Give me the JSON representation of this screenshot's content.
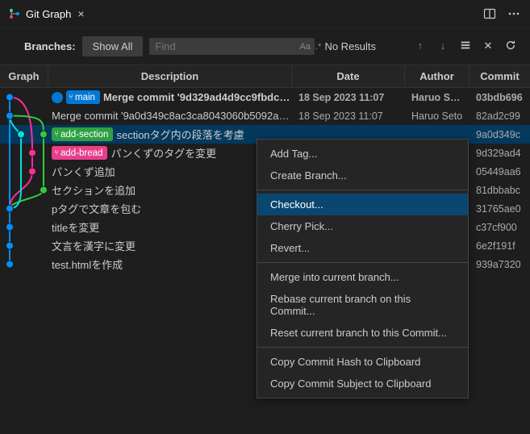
{
  "tab": {
    "title": "Git Graph"
  },
  "toolbar": {
    "branches_label": "Branches:",
    "branches_value": "Show All",
    "search_placeholder": "Find",
    "no_results": "No Results"
  },
  "headers": {
    "graph": "Graph",
    "description": "Description",
    "date": "Date",
    "author": "Author",
    "commit": "Commit"
  },
  "colors": {
    "blue": "#0090ff",
    "green": "#2ecc40",
    "pink": "#ff2e9a",
    "cyan": "#00e0e0"
  },
  "rows": [
    {
      "bold": true,
      "selected": false,
      "head": true,
      "branches": [
        {
          "style": "bt-blue",
          "label": "main"
        }
      ],
      "desc": "Merge commit '9d329ad4d9cc9fbdc…",
      "date": "18 Sep 2023 11:07",
      "author": "Haruo Seto",
      "hash": "03bdb696"
    },
    {
      "bold": false,
      "selected": false,
      "head": false,
      "branches": [],
      "desc": "Merge commit '9a0d349c8ac3ca8043060b5092a35c…",
      "date": "18 Sep 2023 11:07",
      "author": "Haruo Seto",
      "hash": "82ad2c99"
    },
    {
      "bold": false,
      "selected": true,
      "head": false,
      "branches": [
        {
          "style": "bt-green",
          "label": "add-section"
        }
      ],
      "desc": "sectionタグ内の段落を考慮",
      "date": "",
      "author": "",
      "hash": "9a0d349c"
    },
    {
      "bold": false,
      "selected": false,
      "head": false,
      "branches": [
        {
          "style": "bt-pink",
          "label": "add-bread"
        }
      ],
      "desc": "パンくずのタグを変更",
      "date": "",
      "author": "",
      "hash": "9d329ad4"
    },
    {
      "bold": false,
      "selected": false,
      "head": false,
      "branches": [],
      "desc": "パンくず追加",
      "date": "",
      "author": "",
      "hash": "05449aa6"
    },
    {
      "bold": false,
      "selected": false,
      "head": false,
      "branches": [],
      "desc": "セクションを追加",
      "date": "",
      "author": "",
      "hash": "81dbbabc"
    },
    {
      "bold": false,
      "selected": false,
      "head": false,
      "branches": [],
      "desc": "pタグで文章を包む",
      "date": "",
      "author": "",
      "hash": "31765ae0"
    },
    {
      "bold": false,
      "selected": false,
      "head": false,
      "branches": [],
      "desc": "titleを変更",
      "date": "",
      "author": "",
      "hash": "c37cf900"
    },
    {
      "bold": false,
      "selected": false,
      "head": false,
      "branches": [],
      "desc": "文言を漢字に変更",
      "date": "",
      "author": "",
      "hash": "6e2f191f"
    },
    {
      "bold": false,
      "selected": false,
      "head": false,
      "branches": [],
      "desc": "test.htmlを作成",
      "date": "",
      "author": "",
      "hash": "939a7320"
    }
  ],
  "context_menu": {
    "items": [
      {
        "label": "Add Tag...",
        "sep": false
      },
      {
        "label": "Create Branch...",
        "sep": false
      },
      {
        "sep": true
      },
      {
        "label": "Checkout...",
        "hover": true,
        "sep": false
      },
      {
        "label": "Cherry Pick...",
        "sep": false
      },
      {
        "label": "Revert...",
        "sep": false
      },
      {
        "sep": true
      },
      {
        "label": "Merge into current branch...",
        "sep": false
      },
      {
        "label": "Rebase current branch on this Commit...",
        "sep": false
      },
      {
        "label": "Reset current branch to this Commit...",
        "sep": false
      },
      {
        "sep": true
      },
      {
        "label": "Copy Commit Hash to Clipboard",
        "sep": false
      },
      {
        "label": "Copy Commit Subject to Clipboard",
        "sep": false
      }
    ]
  }
}
